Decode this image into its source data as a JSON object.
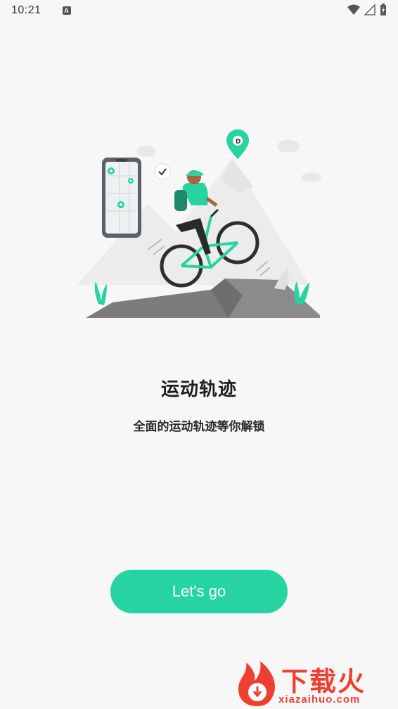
{
  "status_bar": {
    "time": "10:21",
    "notification_icon": "a-icon",
    "wifi_icon": "wifi-icon",
    "signal_icon": "signal-icon",
    "battery_icon": "battery-charging-icon"
  },
  "onboarding": {
    "illustration": "cyclist-mountain-illustration",
    "title": "运动轨迹",
    "subtitle": "全面的运动轨迹等你解锁",
    "cta_label": "Let's go"
  },
  "watermark": {
    "title": "下载火",
    "url": "xiazaihuo.com"
  },
  "colors": {
    "accent": "#26d3a1",
    "background": "#f7f7f7",
    "watermark": "#ef3f30"
  }
}
